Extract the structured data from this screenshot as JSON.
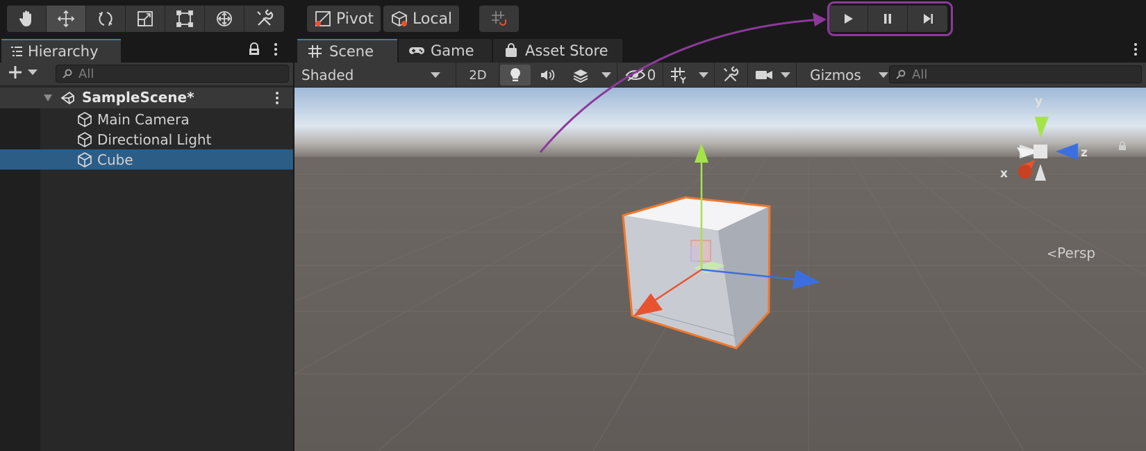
{
  "toolbar": {
    "tools": [
      {
        "name": "hand-tool",
        "icon": "hand-icon"
      },
      {
        "name": "move-tool",
        "icon": "move-icon",
        "active": true
      },
      {
        "name": "rotate-tool",
        "icon": "rotate-icon"
      },
      {
        "name": "scale-tool",
        "icon": "scale-icon"
      },
      {
        "name": "rect-tool",
        "icon": "rect-icon"
      },
      {
        "name": "transform-tool",
        "icon": "transform-icon"
      },
      {
        "name": "custom-tool",
        "icon": "tools-icon"
      }
    ],
    "pivot_label": "Pivot",
    "local_label": "Local",
    "playback": [
      "play-icon",
      "pause-icon",
      "step-icon"
    ],
    "highlight_color": "#8c3a9a"
  },
  "hierarchy": {
    "tab_label": "Hierarchy",
    "search_placeholder": "All",
    "scene_name": "SampleScene*",
    "items": [
      {
        "label": "Main Camera",
        "selected": false
      },
      {
        "label": "Directional Light",
        "selected": false
      },
      {
        "label": "Cube",
        "selected": true
      }
    ]
  },
  "scene": {
    "tabs": [
      {
        "label": "Scene",
        "icon": "grid-icon",
        "active": true
      },
      {
        "label": "Game",
        "icon": "gamepad-icon",
        "active": false
      },
      {
        "label": "Asset Store",
        "icon": "bag-icon",
        "active": false
      }
    ],
    "shading_mode": "Shaded",
    "mode_2d": "2D",
    "hidden_count": "0",
    "gizmos_label": "Gizmos",
    "search_placeholder": "All",
    "projection_label": "Persp",
    "axis_x": "x",
    "axis_y": "y",
    "axis_z": "z"
  },
  "colors": {
    "selection": "#2c5d87",
    "tab_accent": "#3a79bb",
    "axis_x": "#e8532f",
    "axis_y": "#a5e34a",
    "axis_z": "#3b6fe0",
    "outline": "#f0782c"
  }
}
